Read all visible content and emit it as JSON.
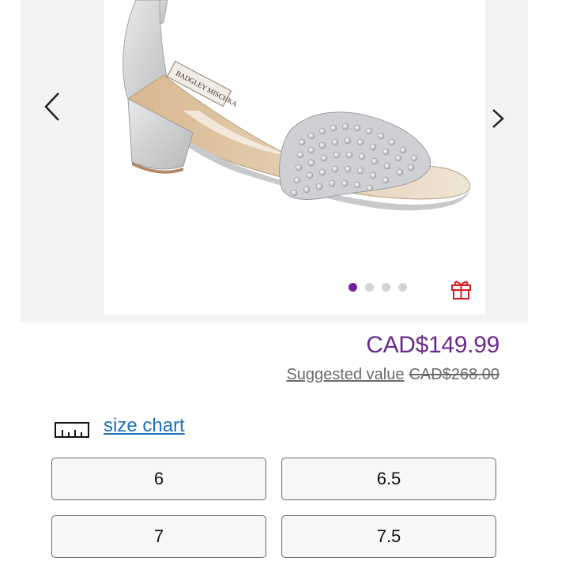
{
  "gallery": {
    "brand_print": "BADGLEY MISCHKA",
    "prev_icon": "chevron-left-icon",
    "next_icon": "chevron-right-icon",
    "dots_total": 4,
    "dots_active": 1,
    "gift_icon": "gift-icon",
    "accent_color": "#7a1f9c"
  },
  "pricing": {
    "price": "CAD$149.99",
    "suggested_label": "Suggested value",
    "suggested_price": "CAD$268.00",
    "price_color": "#6c2a8c"
  },
  "size_chart": {
    "icon": "ruler-icon",
    "label": "size chart",
    "link_color": "#1f6fbf"
  },
  "sizes": [
    "6",
    "6.5",
    "7",
    "7.5"
  ]
}
